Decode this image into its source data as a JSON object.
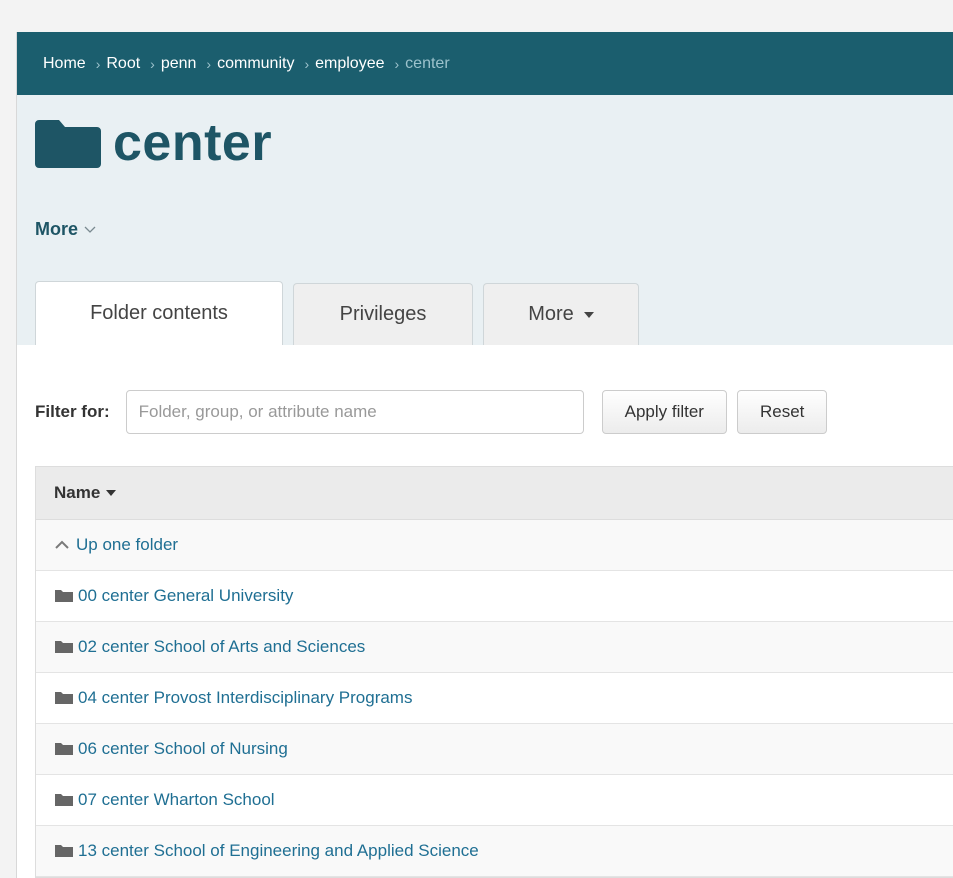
{
  "breadcrumb": [
    {
      "label": "Home"
    },
    {
      "label": "Root"
    },
    {
      "label": "penn"
    },
    {
      "label": "community"
    },
    {
      "label": "employee"
    },
    {
      "label": "center"
    }
  ],
  "breadcrumb_separator": "›",
  "page": {
    "title": "center",
    "more_label": "More"
  },
  "tabs": [
    {
      "label": "Folder contents",
      "active": true
    },
    {
      "label": "Privileges",
      "active": false
    },
    {
      "label": "More",
      "active": false
    }
  ],
  "filter": {
    "label": "Filter for:",
    "placeholder": "Folder, group, or attribute name",
    "apply_label": "Apply filter",
    "reset_label": "Reset"
  },
  "table": {
    "column_name": "Name",
    "up_folder": "Up one folder",
    "rows": [
      "00 center General University",
      "02 center School of Arts and Sciences",
      "04 center Provost Interdisciplinary Programs",
      "06 center School of Nursing",
      "07 center Wharton School",
      "13 center School of Engineering and Applied Science"
    ]
  },
  "colors": {
    "breadcrumb_bg": "#1b5e6e",
    "header_bg": "#e9f0f3",
    "title": "#1e5565",
    "link": "#1f6f93"
  },
  "icons": {
    "title_icon": "folder-icon",
    "row_icon": "folder-icon",
    "up_icon": "chevron-up-icon"
  }
}
